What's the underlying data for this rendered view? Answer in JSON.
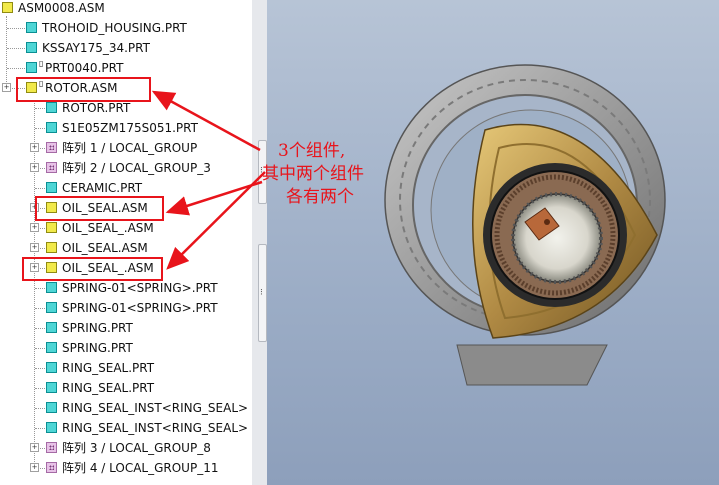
{
  "tree": {
    "root": "ASM0008.ASM",
    "items": [
      {
        "label": "TROHOID_HOUSING.PRT",
        "icon": "part-icon"
      },
      {
        "label": "KSSAY175_34.PRT",
        "icon": "part-icon"
      },
      {
        "label": "PRT0040.PRT",
        "icon": "part-icon"
      },
      {
        "label": "ROTOR.ASM",
        "icon": "assembly-icon"
      },
      {
        "label": "ROTOR.PRT",
        "icon": "part-icon"
      },
      {
        "label": "S1E05ZM175S051.PRT",
        "icon": "part-icon"
      },
      {
        "label": "阵列 1 / LOCAL_GROUP",
        "icon": "pattern-icon"
      },
      {
        "label": "阵列 2 / LOCAL_GROUP_3",
        "icon": "pattern-icon"
      },
      {
        "label": "CERAMIC.PRT",
        "icon": "part-icon"
      },
      {
        "label": "OIL_SEAL.ASM",
        "icon": "assembly-icon"
      },
      {
        "label": "OIL_SEAL_.ASM",
        "icon": "assembly-icon"
      },
      {
        "label": "OIL_SEAL.ASM",
        "icon": "assembly-icon"
      },
      {
        "label": "OIL_SEAL_.ASM",
        "icon": "assembly-icon"
      },
      {
        "label": "SPRING-01<SPRING>.PRT",
        "icon": "part-icon"
      },
      {
        "label": "SPRING-01<SPRING>.PRT",
        "icon": "part-icon"
      },
      {
        "label": "SPRING.PRT",
        "icon": "part-icon"
      },
      {
        "label": "SPRING.PRT",
        "icon": "part-icon"
      },
      {
        "label": "RING_SEAL.PRT",
        "icon": "part-icon"
      },
      {
        "label": "RING_SEAL.PRT",
        "icon": "part-icon"
      },
      {
        "label": "RING_SEAL_INST<RING_SEAL>",
        "icon": "part-icon"
      },
      {
        "label": "RING_SEAL_INST<RING_SEAL>",
        "icon": "part-icon"
      },
      {
        "label": "阵列 3 / LOCAL_GROUP_8",
        "icon": "pattern-icon"
      },
      {
        "label": "阵列 4 / LOCAL_GROUP_11",
        "icon": "pattern-icon"
      }
    ]
  },
  "annotation": {
    "line1": "3个组件,",
    "line2": "其中两个组件",
    "line3": "各有两个"
  },
  "colors": {
    "highlight": "#e8141b",
    "viewport_bg": "#9cadc6",
    "housing": "#8f8f8f",
    "rotor_gold": "#b08a44"
  }
}
